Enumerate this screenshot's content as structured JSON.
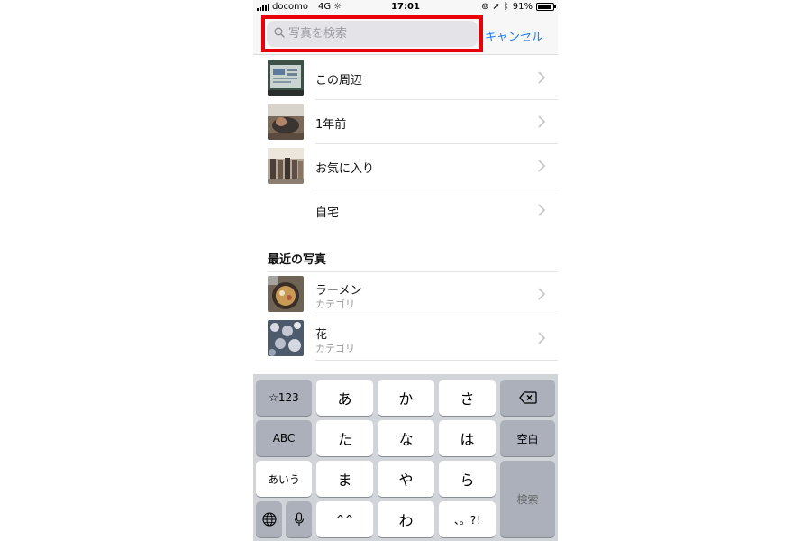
{
  "status_bar": {
    "carrier": "docomo",
    "network": "4G",
    "time": "17:01",
    "battery": "91%"
  },
  "search": {
    "placeholder": "写真を検索",
    "value": "",
    "cancel_label": "キャンセル",
    "highlight_color": "#e8000b"
  },
  "suggestions": [
    {
      "label": "この周辺",
      "thumb": "photo-thumbnail"
    },
    {
      "label": "1年前",
      "thumb": "photo-thumbnail"
    },
    {
      "label": "お気に入り",
      "thumb": "photo-thumbnail"
    },
    {
      "label": "自宅",
      "thumb": ""
    }
  ],
  "recent": {
    "title": "最近の写真",
    "items": [
      {
        "label": "ラーメン",
        "sublabel": "カテゴリ"
      },
      {
        "label": "花",
        "sublabel": "カテゴリ"
      }
    ]
  },
  "keyboard": {
    "row1": [
      "☆123",
      "あ",
      "か",
      "さ"
    ],
    "row2": [
      "ABC",
      "た",
      "な",
      "は",
      "空白"
    ],
    "row3": [
      "あいう",
      "ま",
      "や",
      "ら"
    ],
    "row4": [
      "",
      "",
      "^^",
      "わ",
      "、。?!"
    ],
    "search_key": "検索",
    "delete_icon": "delete-icon",
    "globe_icon": "globe-icon",
    "mic_icon": "microphone-icon"
  },
  "colors": {
    "accent": "#1a7cf5",
    "keyboard_bg": "#d1d4d9",
    "key_gray": "#abb0ba"
  }
}
